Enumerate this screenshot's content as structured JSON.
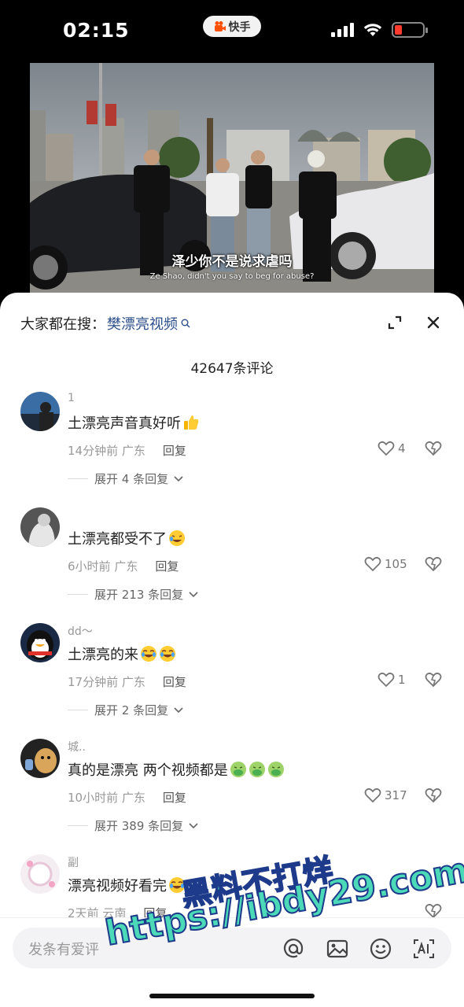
{
  "status_bar": {
    "time": "02:15",
    "app_name": "快手"
  },
  "video": {
    "subtitle_cn": "泽少你不是说求虐吗",
    "subtitle_en": "Ze Shao, didn't you say to beg for abuse?"
  },
  "sheet": {
    "search_prefix": "大家都在搜：",
    "search_keyword": "樊漂亮视频",
    "comment_count_title": "42647条评论"
  },
  "comments": [
    {
      "username": "1",
      "text": "土漂亮声音真好听",
      "emoji": [
        "thumbs-up"
      ],
      "time": "14分钟前",
      "location": "广东",
      "reply": "回复",
      "likes": "4",
      "expand": "展开 4 条回复"
    },
    {
      "username": "",
      "text": "土漂亮都受不了",
      "emoji": [
        "laugh-cry"
      ],
      "time": "6小时前",
      "location": "广东",
      "reply": "回复",
      "likes": "105",
      "expand": "展开 213 条回复"
    },
    {
      "username": "dd～",
      "text": "土漂亮的来",
      "emoji": [
        "joy",
        "joy"
      ],
      "time": "17分钟前",
      "location": "广东",
      "reply": "回复",
      "likes": "1",
      "expand": "展开 2 条回复"
    },
    {
      "username": "城..",
      "text": "真的是漂亮 两个视频都是",
      "emoji": [
        "vomit",
        "vomit",
        "vomit"
      ],
      "time": "10小时前",
      "location": "广东",
      "reply": "回复",
      "likes": "317",
      "expand": "展开 389 条回复"
    },
    {
      "username": "副",
      "text": "漂亮视频好看完",
      "emoji": [
        "joy"
      ],
      "time": "2天前",
      "location": "云南",
      "reply": "回复",
      "likes": "",
      "expand": ""
    }
  ],
  "input": {
    "placeholder": "发条有爱评"
  },
  "watermark": {
    "text_cn": "黑料不打烊",
    "url": "https://ibdy29.com"
  },
  "colors": {
    "keyword": "#2b4f8a",
    "watermark": "#4bd9b8",
    "battery": "#ff3b30"
  }
}
